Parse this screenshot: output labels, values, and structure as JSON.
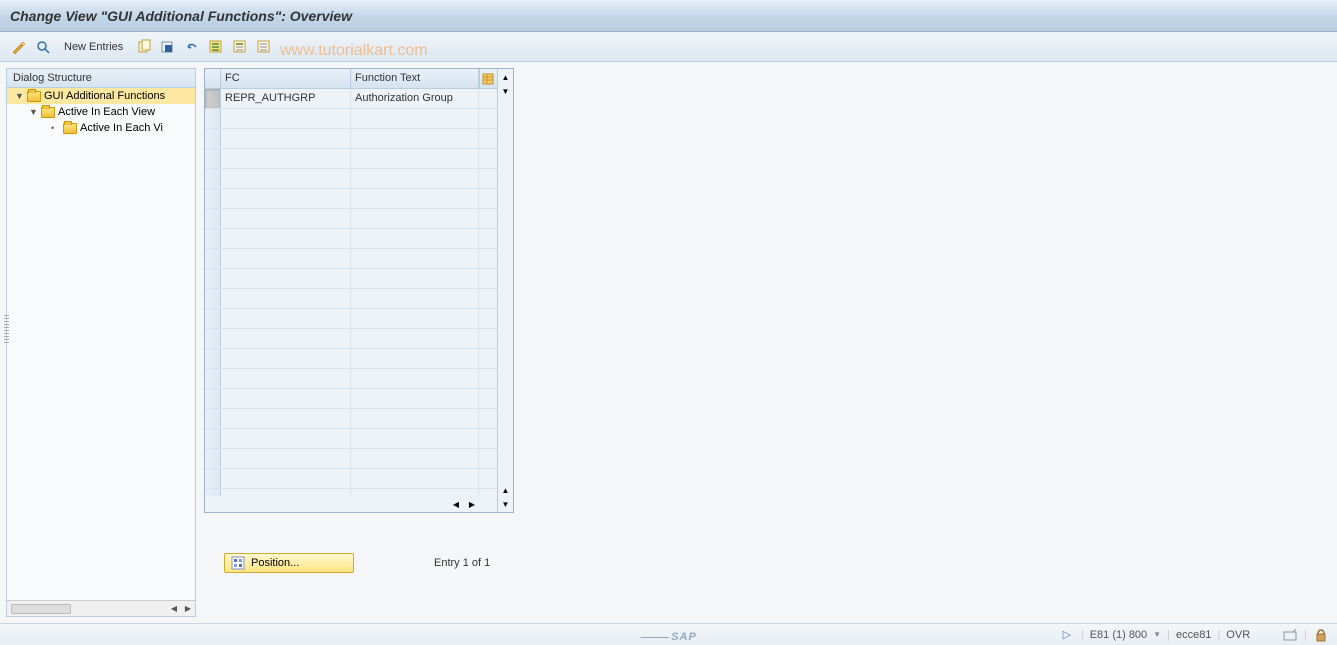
{
  "title": "Change View \"GUI Additional Functions\": Overview",
  "toolbar": {
    "new_entries": "New Entries"
  },
  "watermark": "www.tutorialkart.com",
  "tree": {
    "header": "Dialog Structure",
    "items": [
      {
        "label": "GUI Additional Functions",
        "selected": true,
        "expandable": true,
        "open": true
      },
      {
        "label": "Active In Each View",
        "selected": false,
        "expandable": true,
        "open": false
      },
      {
        "label": "Active In Each Vi",
        "selected": false,
        "expandable": false,
        "open": false
      }
    ]
  },
  "table": {
    "columns": {
      "fc": "FC",
      "ft": "Function Text"
    },
    "rows": [
      {
        "fc": "REPR_AUTHGRP",
        "ft": "Authorization Group",
        "selected": true
      }
    ],
    "empty_rows": 20
  },
  "footer": {
    "position_label": "Position...",
    "entry_text": "Entry 1 of 1"
  },
  "status": {
    "session": "E81 (1) 800",
    "server": "ecce81",
    "mode": "OVR"
  }
}
